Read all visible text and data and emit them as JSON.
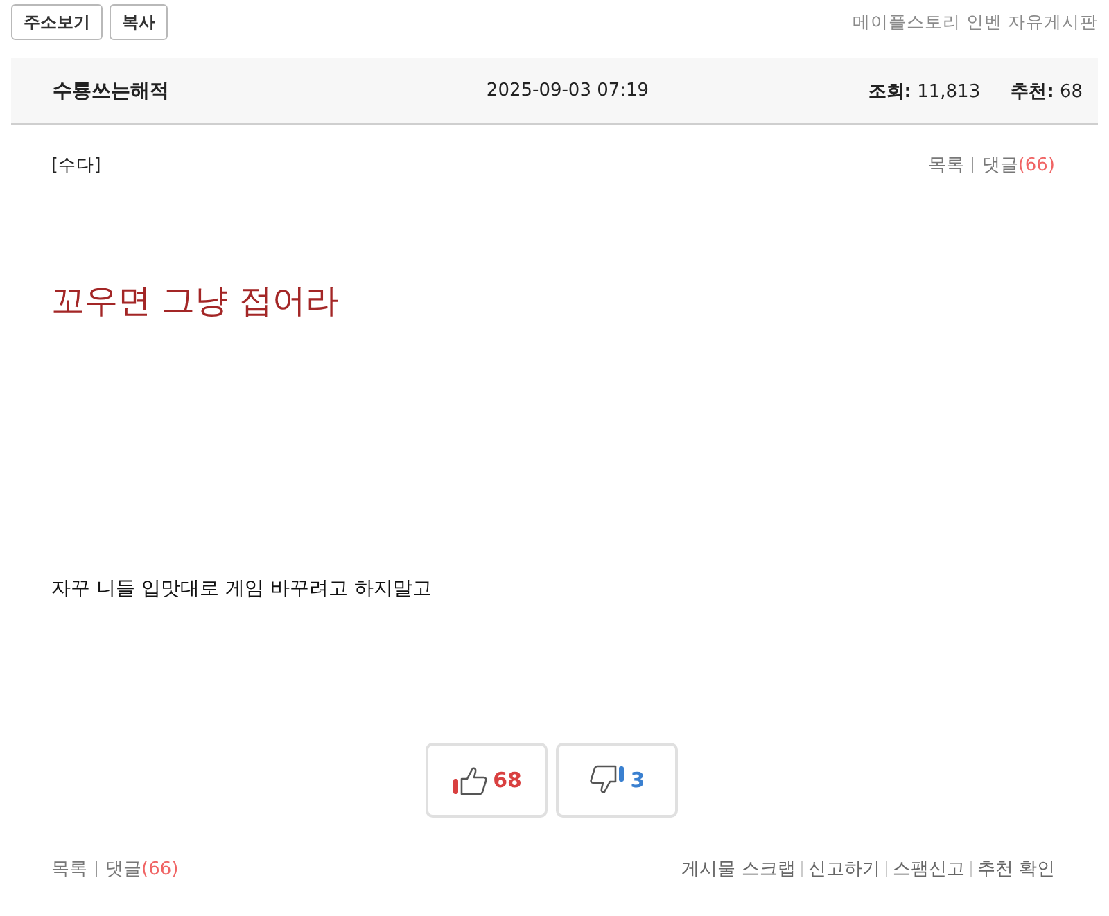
{
  "toolbar": {
    "buttons": [
      "주소보기",
      "복사"
    ],
    "board_name": "메이플스토리 인벤 자유게시판"
  },
  "header": {
    "author": "수룡쓰는해적",
    "date": "2025-09-03 07:19",
    "stats": [
      {
        "label": "조회:",
        "value": "11,813"
      },
      {
        "label": "추천:",
        "value": "68"
      }
    ]
  },
  "category": "[수다]",
  "top_links": {
    "list": "목록",
    "comments": "댓글",
    "comment_count": "(66)"
  },
  "title": "꼬우면 그냥 접어라",
  "body": [
    "자꾸 니들 입맛대로 게임 바꾸려고 하지말고"
  ],
  "votes": [
    {
      "kind": "up",
      "count": "68",
      "color": "#d94040"
    },
    {
      "kind": "down",
      "count": "3",
      "color": "#3a80d0"
    }
  ],
  "footer": {
    "list": "목록",
    "comments": "댓글",
    "comment_count": "(66)",
    "actions": [
      "게시물 스크랩",
      "신고하기",
      "스팸신고",
      "추천 확인"
    ]
  }
}
